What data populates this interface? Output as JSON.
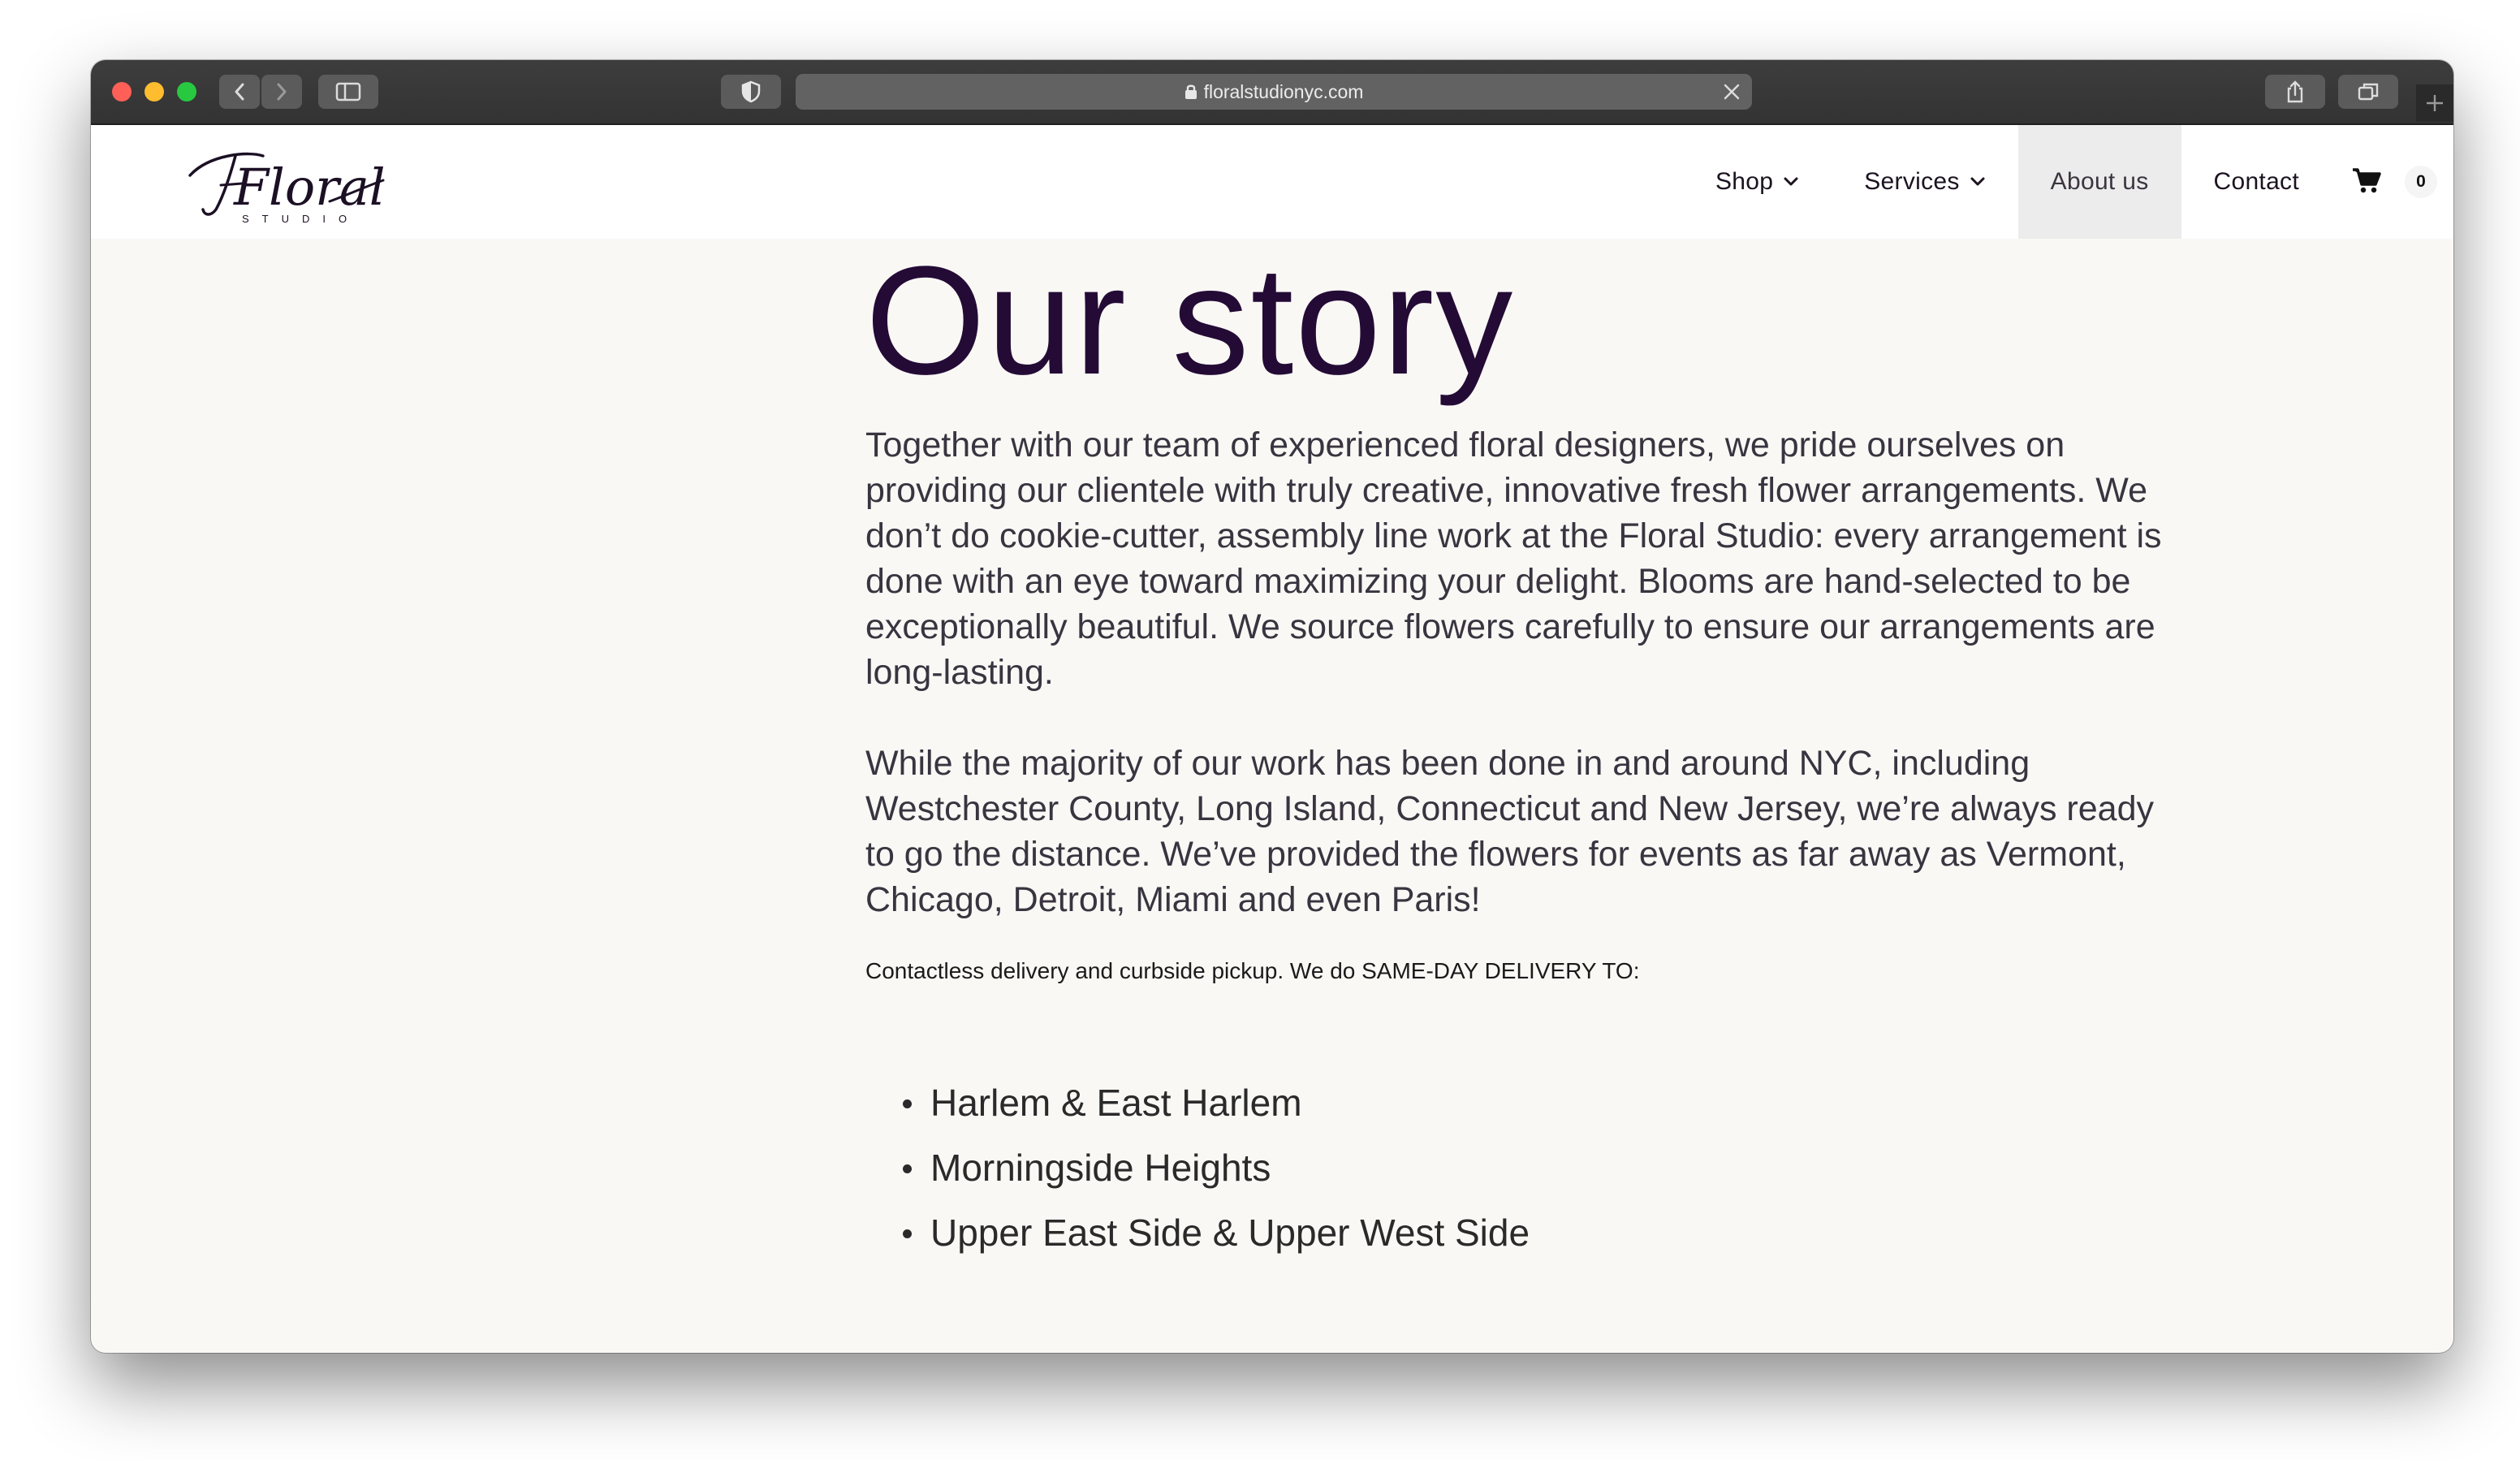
{
  "browser": {
    "url": "floralstudionyc.com"
  },
  "site": {
    "logo_text": "Floral",
    "logo_sub": "STUDIO",
    "nav": {
      "shop": "Shop",
      "services": "Services",
      "about": "About us",
      "contact": "Contact",
      "cart_count": "0"
    }
  },
  "page": {
    "title": "Our story",
    "paragraph1": "Together with our team of experienced floral designers, we pride ourselves on providing our clientele with truly creative, innovative fresh flower arrangements. We don’t do cookie-cutter, assembly line work at the Floral Studio: every arrangement is done with an eye toward maximizing your delight. Blooms are hand-selected to be exceptionally beautiful. We source flowers carefully to ensure our arrangements are long-lasting.",
    "paragraph2": "While the majority of our work has been done in and around NYC, including Westchester County, Long Island, Connecticut and New Jersey, we’re always ready to go the distance. We’ve provided the flowers for events as far away as Vermont, Chicago, Detroit, Miami and even Paris!",
    "delivery_note": "Contactless delivery and curbside pickup. We do SAME-DAY DELIVERY TO:",
    "areas": [
      "Harlem & East Harlem",
      "Morningside Heights",
      "Upper East Side & Upper West Side"
    ]
  },
  "colors": {
    "headline": "#240b36",
    "titlebar": "#333333",
    "page_bg": "#faf8f5"
  }
}
